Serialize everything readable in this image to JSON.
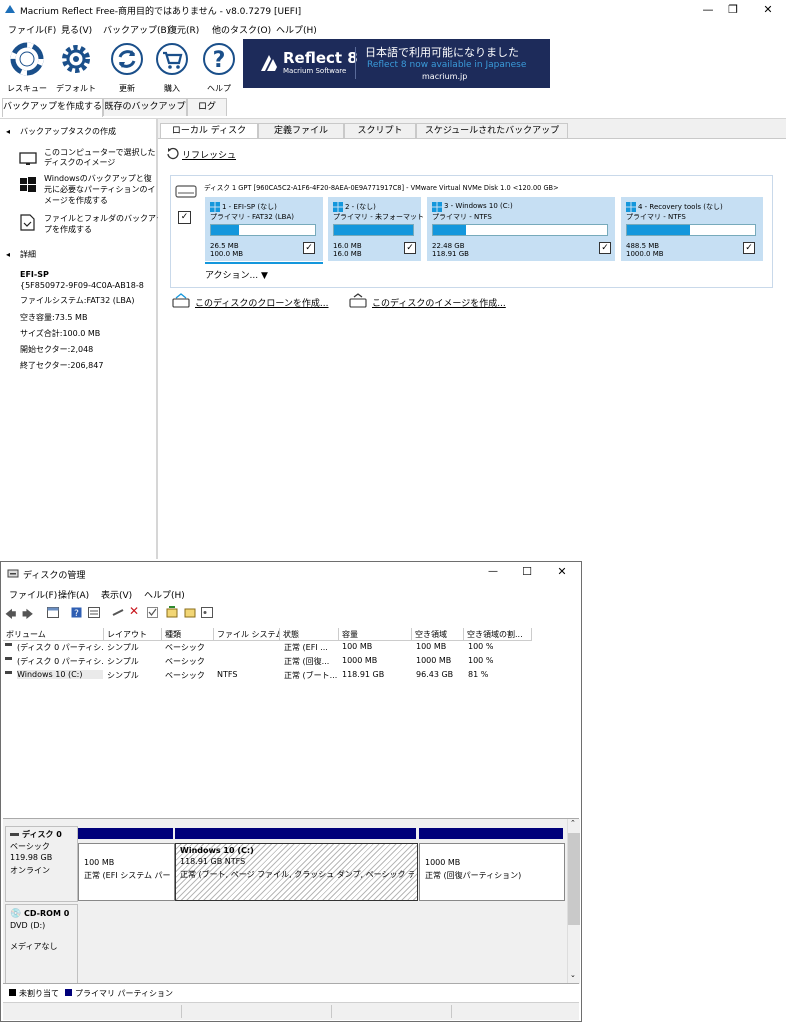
{
  "macrium": {
    "title": "Macrium Reflect Free-商用目的ではありません - v8.0.7279  [UEFI]",
    "menu": [
      "ファイル(F)",
      "見る(V)",
      "バックアップ(B)",
      "復元(R)",
      "他のタスク(O)",
      "ヘルプ(H)"
    ],
    "toolbar": [
      {
        "label": "レスキュー",
        "icon": "rescue-icon"
      },
      {
        "label": "デフォルト",
        "icon": "gear-icon"
      },
      {
        "label": "更新",
        "icon": "refresh-icon"
      },
      {
        "label": "購入",
        "icon": "cart-icon"
      },
      {
        "label": "ヘルプ",
        "icon": "help-icon"
      }
    ],
    "banner": {
      "brand": "Reflect 8",
      "brand_sub": "Macrium Software",
      "line1": "日本語で利用可能になりました",
      "line2": "Reflect 8 now available in Japanese",
      "line3": "macrium.jp",
      "bg_color": "#1d2b5a",
      "accent_color": "#3a9ad9"
    },
    "top_tabs": [
      "バックアップを作成する",
      "既存のバックアップ",
      "ログ"
    ],
    "sidebar": {
      "tasks_header": "バックアップタスクの作成",
      "task1": [
        "このコンピューターで選択した",
        "ディスクのイメージ"
      ],
      "task2": [
        "Windowsのバックアップと復",
        "元に必要なパーティションのイ",
        "メージを作成する"
      ],
      "task3": [
        "ファイルとフォルダのバックアッ",
        "プを作成する"
      ],
      "details_header": "詳細",
      "name": "EFI-SP",
      "guid": "{5F850972-9F09-4C0A-AB18-8",
      "filesystem": "ファイルシステム:FAT32 (LBA)",
      "free": "空き容量:73.5 MB",
      "size": "サイズ合計:100.0 MB",
      "start": "開始セクター:2,048",
      "end": "終了セクター:206,847"
    },
    "main_tabs": [
      "ローカル ディスク",
      "定義ファイル",
      "スクリプト",
      "スケジュールされたバックアップ"
    ],
    "refresh": "リフレッシュ",
    "disk_header": "ディスク 1 GPT [960CA5C2-A1F6-4F20-8AEA-0E9A771917C8] - VMware Virtual NVMe Disk 1.0  <120.00 GB>",
    "partitions": [
      {
        "name": "1 - EFI-SP (なし)",
        "type": "プライマリ - FAT32 (LBA)",
        "used": "26.5 MB",
        "total": "100.0 MB",
        "fill": 0.27
      },
      {
        "name": "2 - (なし)",
        "type": "プライマリ - 未フォーマット",
        "used": "16.0 MB",
        "total": "16.0 MB",
        "fill": 1.0
      },
      {
        "name": "3 - Windows 10 (C:)",
        "type": "プライマリ - NTFS",
        "used": "22.48 GB",
        "total": "118.91 GB",
        "fill": 0.19
      },
      {
        "name": "4 - Recovery tools (なし)",
        "type": "プライマリ - NTFS",
        "used": "488.5 MB",
        "total": "1000.0 MB",
        "fill": 0.49
      }
    ],
    "actions": "アクション...",
    "clone_link": "このディスクのクローンを作成...",
    "image_link": "このディスクのイメージを作成..."
  },
  "diskmgmt": {
    "title": "ディスクの管理",
    "menu": [
      "ファイル(F)",
      "操作(A)",
      "表示(V)",
      "ヘルプ(H)"
    ],
    "columns": [
      "ボリューム",
      "レイアウト",
      "種類",
      "ファイル システム",
      "状態",
      "容量",
      "空き領域",
      "空き領域の割..."
    ],
    "rows": [
      [
        "(ディスク 0 パーティシ...",
        "シンプル",
        "ベーシック",
        "",
        "正常 (EFI ...",
        "100 MB",
        "100 MB",
        "100 %"
      ],
      [
        "(ディスク 0 パーティシ...",
        "シンプル",
        "ベーシック",
        "",
        "正常 (回復...",
        "1000 MB",
        "1000 MB",
        "100 %"
      ],
      [
        "Windows 10 (C:)",
        "シンプル",
        "ベーシック",
        "NTFS",
        "正常 (ブート...",
        "118.91 GB",
        "96.43 GB",
        "81 %"
      ]
    ],
    "disk0": {
      "name": "ディスク 0",
      "type": "ベーシック",
      "size": "119.98 GB",
      "status": "オンライン"
    },
    "volumes": [
      {
        "title": "",
        "size": "100 MB",
        "status": "正常 (EFI システム パー"
      },
      {
        "title": "Windows 10  (C:)",
        "size": "118.91 GB NTFS",
        "status": "正常 (ブート, ページ ファイル, クラッシュ ダンプ, ベーシック データ パー"
      },
      {
        "title": "",
        "size": "1000 MB",
        "status": "正常 (回復パーティション)"
      }
    ],
    "cdrom": {
      "name": "CD-ROM 0",
      "type": "DVD (D:)",
      "status": "メディアなし"
    },
    "legend": [
      "未割り当て",
      "プライマリ パーティション"
    ],
    "colors": {
      "primary": "#00007a",
      "unallocated": "#000000"
    }
  }
}
